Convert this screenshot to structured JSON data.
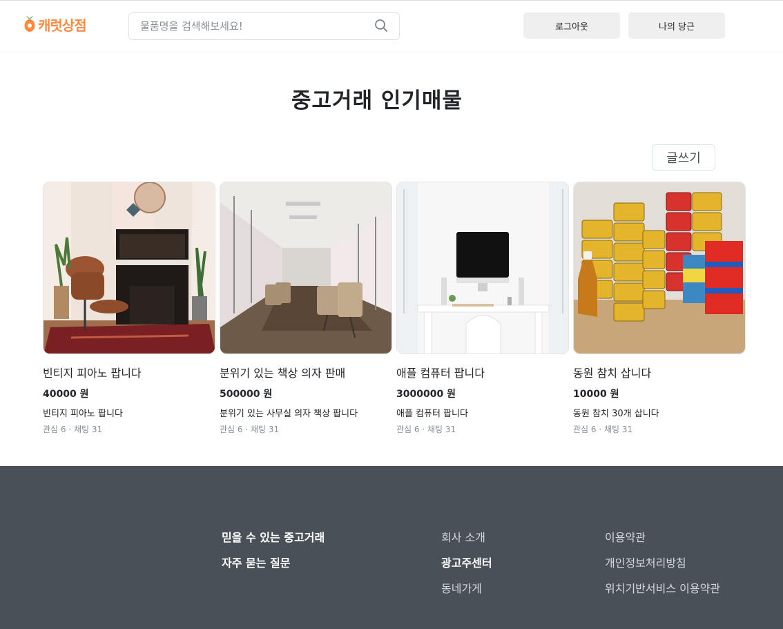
{
  "header": {
    "logo_text": "캐럿상점",
    "search_placeholder": "물품명을 검색해보세요!",
    "logout_label": "로그아웃",
    "my_carrot_label": "나의 당근"
  },
  "main": {
    "title": "중고거래 인기매물",
    "write_label": "글쓰기",
    "products": [
      {
        "title": "빈티지 피아노 팝니다",
        "price": "40000 원",
        "description": "빈티지 피아노 팝니다",
        "meta": "관심 6 · 채팅 31"
      },
      {
        "title": "분위기 있는 책상 의자 판매",
        "price": "500000 원",
        "description": "분위기 있는 사무실 의자 책상 팝니다",
        "meta": "관심 6 · 채팅 31"
      },
      {
        "title": "애플 컴퓨터 팝니다",
        "price": "3000000 원",
        "description": "애플 컴퓨터 팝니다",
        "meta": "관심 6 · 채팅 31"
      },
      {
        "title": "동원 참치 삽니다",
        "price": "10000 원",
        "description": "동원 참치 30개 삽니다",
        "meta": "관심 6 · 채팅 31"
      }
    ]
  },
  "footer": {
    "col1": [
      "믿을 수 있는 중고거래",
      "자주 묻는 질문"
    ],
    "col2": [
      "회사 소개",
      "광고주센터",
      "동네가게"
    ],
    "col3": [
      "이용약관",
      "개인정보처리방침",
      "위치기반서비스 이용약관"
    ]
  },
  "colors": {
    "brand": "#ff8a3d",
    "footer_bg": "#495057",
    "button_bg": "#efefef"
  },
  "icons": [
    "carrot-logo-icon",
    "search-icon"
  ]
}
